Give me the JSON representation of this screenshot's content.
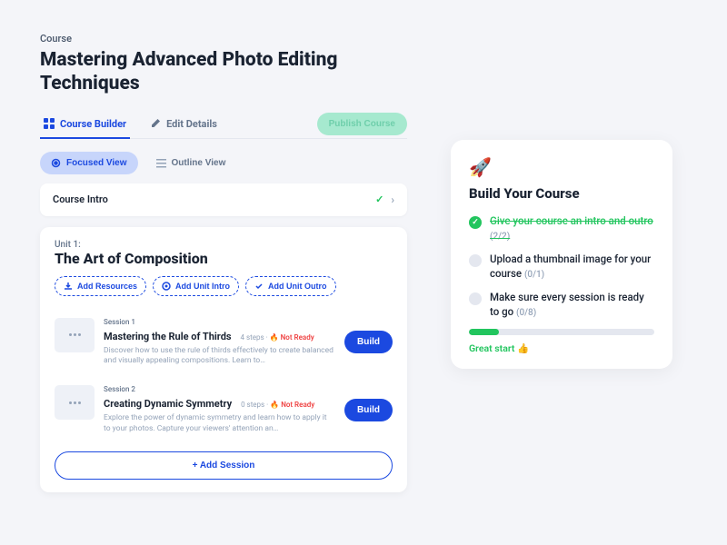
{
  "breadcrumb": "Course",
  "title": "Mastering Advanced Photo Editing Techniques",
  "tabs": {
    "builder": "Course Builder",
    "details": "Edit Details"
  },
  "publish": "Publish Course",
  "views": {
    "focused": "Focused View",
    "outline": "Outline View"
  },
  "intro": {
    "label": "Course Intro"
  },
  "unit": {
    "label": "Unit 1:",
    "title": "The Art of Composition",
    "pills": {
      "resources": "Add Resources",
      "intro": "Add Unit Intro",
      "outro": "Add Unit Outro"
    }
  },
  "sessions": [
    {
      "label": "Session 1",
      "title": "Mastering the Rule of Thirds",
      "steps": "4 steps",
      "status": "Not Ready",
      "desc": "Discover how to use the rule of thirds effectively to create balanced and visually appealing compositions. Learn to…",
      "build": "Build"
    },
    {
      "label": "Session 2",
      "title": "Creating Dynamic Symmetry",
      "steps": "0 steps",
      "status": "Not Ready",
      "desc": "Explore the power of dynamic symmetry and learn how to apply it to your photos. Capture your viewers' attention an…",
      "build": "Build"
    }
  ],
  "add_session": "+  Add Session",
  "checklist": {
    "title": "Build Your Course",
    "items": [
      {
        "text": "Give your course an intro and outro",
        "count": "(2/2)",
        "done": true
      },
      {
        "text": "Upload a thumbnail image for your course",
        "count": "(0/1)",
        "done": false
      },
      {
        "text": "Make sure every session is ready to go",
        "count": "(0/8)",
        "done": false
      }
    ],
    "progress_label": "Great start 👍"
  }
}
